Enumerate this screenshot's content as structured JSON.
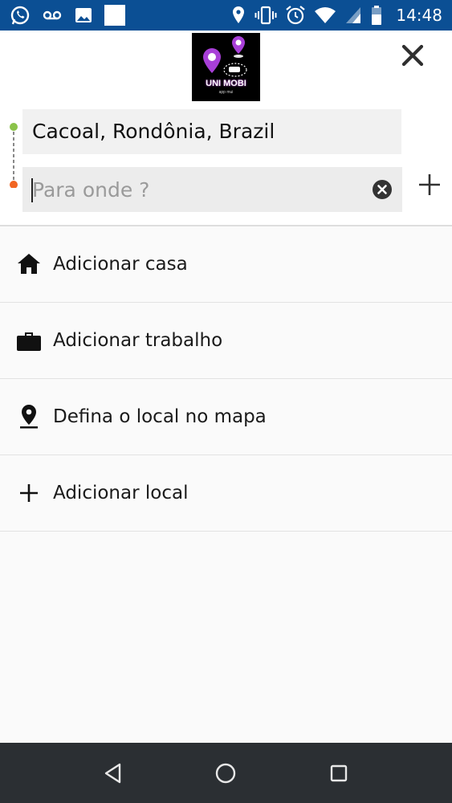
{
  "status_bar": {
    "time": "14:48",
    "left_icons": [
      "whatsapp-icon",
      "voicemail-icon",
      "image-icon",
      "blank-notification-icon"
    ],
    "right_icons": [
      "location-icon",
      "vibrate-icon",
      "alarm-icon",
      "wifi-icon",
      "signal-icon",
      "battery-icon"
    ],
    "background": "#0b4f94"
  },
  "header": {
    "logo_text": "UNI MOBI",
    "logo_subtext": "app mui",
    "origin": "Cacoal, Rondônia, Brazil",
    "destination": {
      "value": "",
      "placeholder": "Para onde ?"
    }
  },
  "colors": {
    "origin_dot": "#8bc34a",
    "destination_dot": "#f26522",
    "logo_pin": "#a83fd8"
  },
  "list": {
    "items": [
      {
        "label": "Adicionar casa",
        "icon": "home-icon"
      },
      {
        "label": "Adicionar trabalho",
        "icon": "briefcase-icon"
      },
      {
        "label": "Defina o local no mapa",
        "icon": "map-pin-icon"
      },
      {
        "label": "Adicionar local",
        "icon": "plus-icon"
      }
    ]
  },
  "navbar": {
    "buttons": [
      "back-icon",
      "home-circle-icon",
      "recents-icon"
    ]
  }
}
